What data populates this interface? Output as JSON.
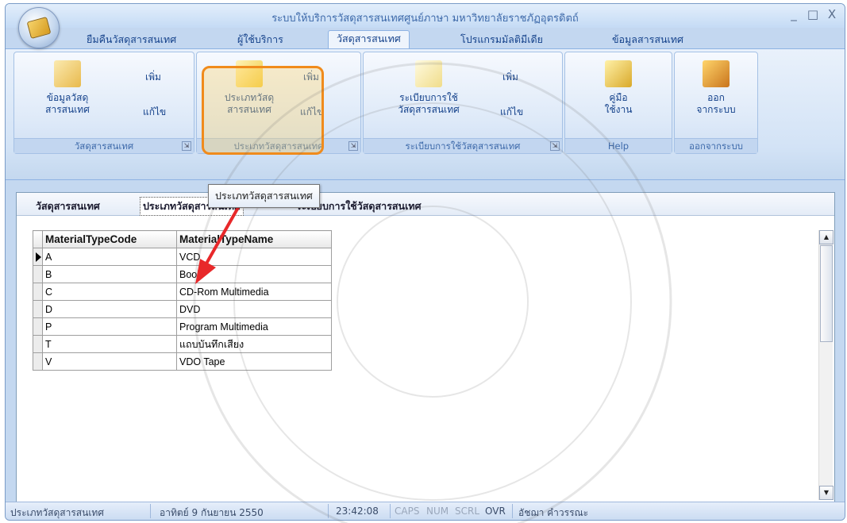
{
  "window": {
    "title": "ระบบให้บริการวัสดุสารสนเทศศูนย์ภาษา มหาวิทยาลัยราชภัฏอุตรดิตถ์",
    "controls": [
      "_",
      "□",
      "X"
    ]
  },
  "tabs": [
    {
      "label": "ยืมคืนวัสดุสารสนเทศ",
      "active": false
    },
    {
      "label": "ผู้ใช้บริการ",
      "active": false
    },
    {
      "label": "วัสดุสารสนเทศ",
      "active": true
    },
    {
      "label": "โปรแกรมมัลติมีเดีย",
      "active": false
    },
    {
      "label": "ข้อมูลสารสนเทศ",
      "active": false
    }
  ],
  "ribbon": {
    "groups": [
      {
        "label": "วัสดุสารสนเทศ",
        "big_line1": "ข้อมูลวัสดุ",
        "big_line2": "สารสนเทศ",
        "add": "เพิ่ม",
        "edit": "แก้ไข"
      },
      {
        "label": "ประเภทวัสดุสารสนเทศ",
        "big_line1": "ประเภทวัสดุ",
        "big_line2": "สารสนเทศ",
        "add": "เพิ่ม",
        "edit": "แก้ไข"
      },
      {
        "label": "ระเบียบการใช้วัสดุสารสนเทศ",
        "big_line1": "ระเบียบการใช้",
        "big_line2": "วัสดุสารสนเทศ",
        "add": "เพิ่ม",
        "edit": "แก้ไข"
      },
      {
        "label": "Help",
        "big_line1": "คู่มือ",
        "big_line2": "ใช้งาน"
      },
      {
        "label": "ออกจากระบบ",
        "big_line1": "ออก",
        "big_line2": "จากระบบ"
      }
    ],
    "launcher": "⇲"
  },
  "tooltip": "ประเภทวัสดุสารสนเทศ",
  "subtabs": [
    {
      "label": "วัสดุสารสนเทศ",
      "active": false
    },
    {
      "label": "ประเภทวัสดุสารสนเทศ",
      "active": true
    },
    {
      "label": "ระเบียบการใช้วัสดุสารสนเทศ",
      "active": false
    }
  ],
  "grid": {
    "columns": [
      "MaterialTypeCode",
      "MaterialTypeName"
    ],
    "rows": [
      [
        "A",
        "VCD"
      ],
      [
        "B",
        "Book"
      ],
      [
        "C",
        "CD-Rom Multimedia"
      ],
      [
        "D",
        "DVD"
      ],
      [
        "P",
        "Program Multimedia"
      ],
      [
        "T",
        "แถบบันทึกเสียง"
      ],
      [
        "V",
        "VDO Tape"
      ]
    ]
  },
  "statusbar": {
    "form": "ประเภทวัสดุสารสนเทศ",
    "date": "อาทิตย์ 9 กันยายน 2550",
    "time": "23:42:08",
    "caps": "CAPS",
    "num": "NUM",
    "scrl": "SCRL",
    "ovr": "OVR",
    "user": "อัชฌา คำวรรณะ"
  },
  "colors": {
    "highlight": "#f08b1c",
    "arrow": "#e8282a",
    "ribbon": "#dde9f8"
  }
}
